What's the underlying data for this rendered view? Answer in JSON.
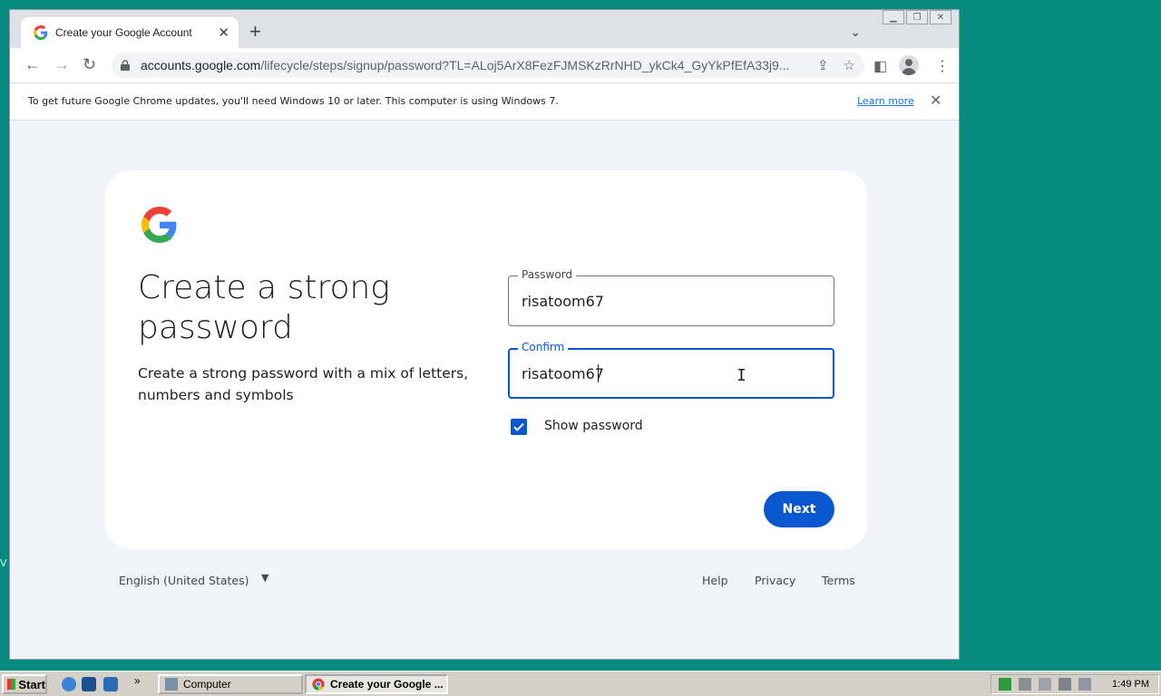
{
  "desktop": {
    "fragment": "V"
  },
  "browser": {
    "tab_title": "Create your Google Account",
    "url_domain": "accounts.google.com",
    "url_path": "/lifecycle/steps/signup/password?TL=ALoj5ArX8FezFJMSKzRrNHD_ykCk4_GyYkPfEfA33j9...",
    "infobar_message": "To get future Google Chrome updates, you'll need Windows 10 or later. This computer is using Windows 7.",
    "infobar_link": "Learn more"
  },
  "page": {
    "heading": "Create a strong password",
    "subtitle": "Create a strong password with a mix of letters, numbers and symbols",
    "password_label": "Password",
    "password_value": "risatoom67",
    "confirm_label": "Confirm",
    "confirm_value": "risatoom67",
    "show_password_label": "Show password",
    "show_password_checked": true,
    "next_label": "Next"
  },
  "footer": {
    "language": "English (United States)",
    "help": "Help",
    "privacy": "Privacy",
    "terms": "Terms"
  },
  "taskbar": {
    "start_label": "Start",
    "items": [
      {
        "label": "Computer"
      },
      {
        "label": "Create your Google ..."
      }
    ],
    "clock": "1:49 PM"
  },
  "colors": {
    "accent": "#0b57d0",
    "desktop": "#078a7f",
    "page_bg": "#f0f4f9"
  }
}
